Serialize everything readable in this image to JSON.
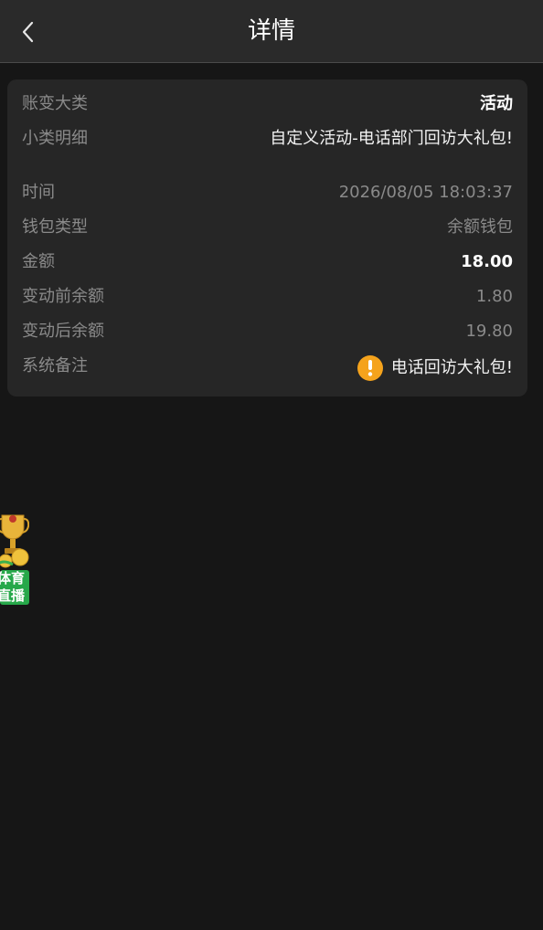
{
  "header": {
    "title": "详情",
    "back_icon": "chevron-left-icon"
  },
  "details": {
    "category": {
      "label": "账变大类",
      "value": "活动"
    },
    "subcategory": {
      "label": "小类明细",
      "value": "自定义活动-电话部门回访大礼包!"
    },
    "time": {
      "label": "时间",
      "value": "2026/08/05 18:03:37"
    },
    "wallet_type": {
      "label": "钱包类型",
      "value": "余额钱包"
    },
    "amount": {
      "label": "金额",
      "value": "18.00"
    },
    "balance_before": {
      "label": "变动前余额",
      "value": "1.80"
    },
    "balance_after": {
      "label": "变动后余额",
      "value": "19.80"
    },
    "remark": {
      "label": "系统备注",
      "value": "电话回访大礼包!",
      "icon": "warning-icon"
    }
  },
  "floating_badge": {
    "line1": "体育",
    "line2": "直播",
    "icon": "trophy-icon"
  },
  "colors": {
    "background": "#161616",
    "navbar": "#2a2a2a",
    "card": "#262626",
    "label": "#8a8a8a",
    "emphasis": "#ffffff",
    "warning": "#f5a31c",
    "badge_green": "#27a84a",
    "trophy_gold": "#e8b43a"
  }
}
